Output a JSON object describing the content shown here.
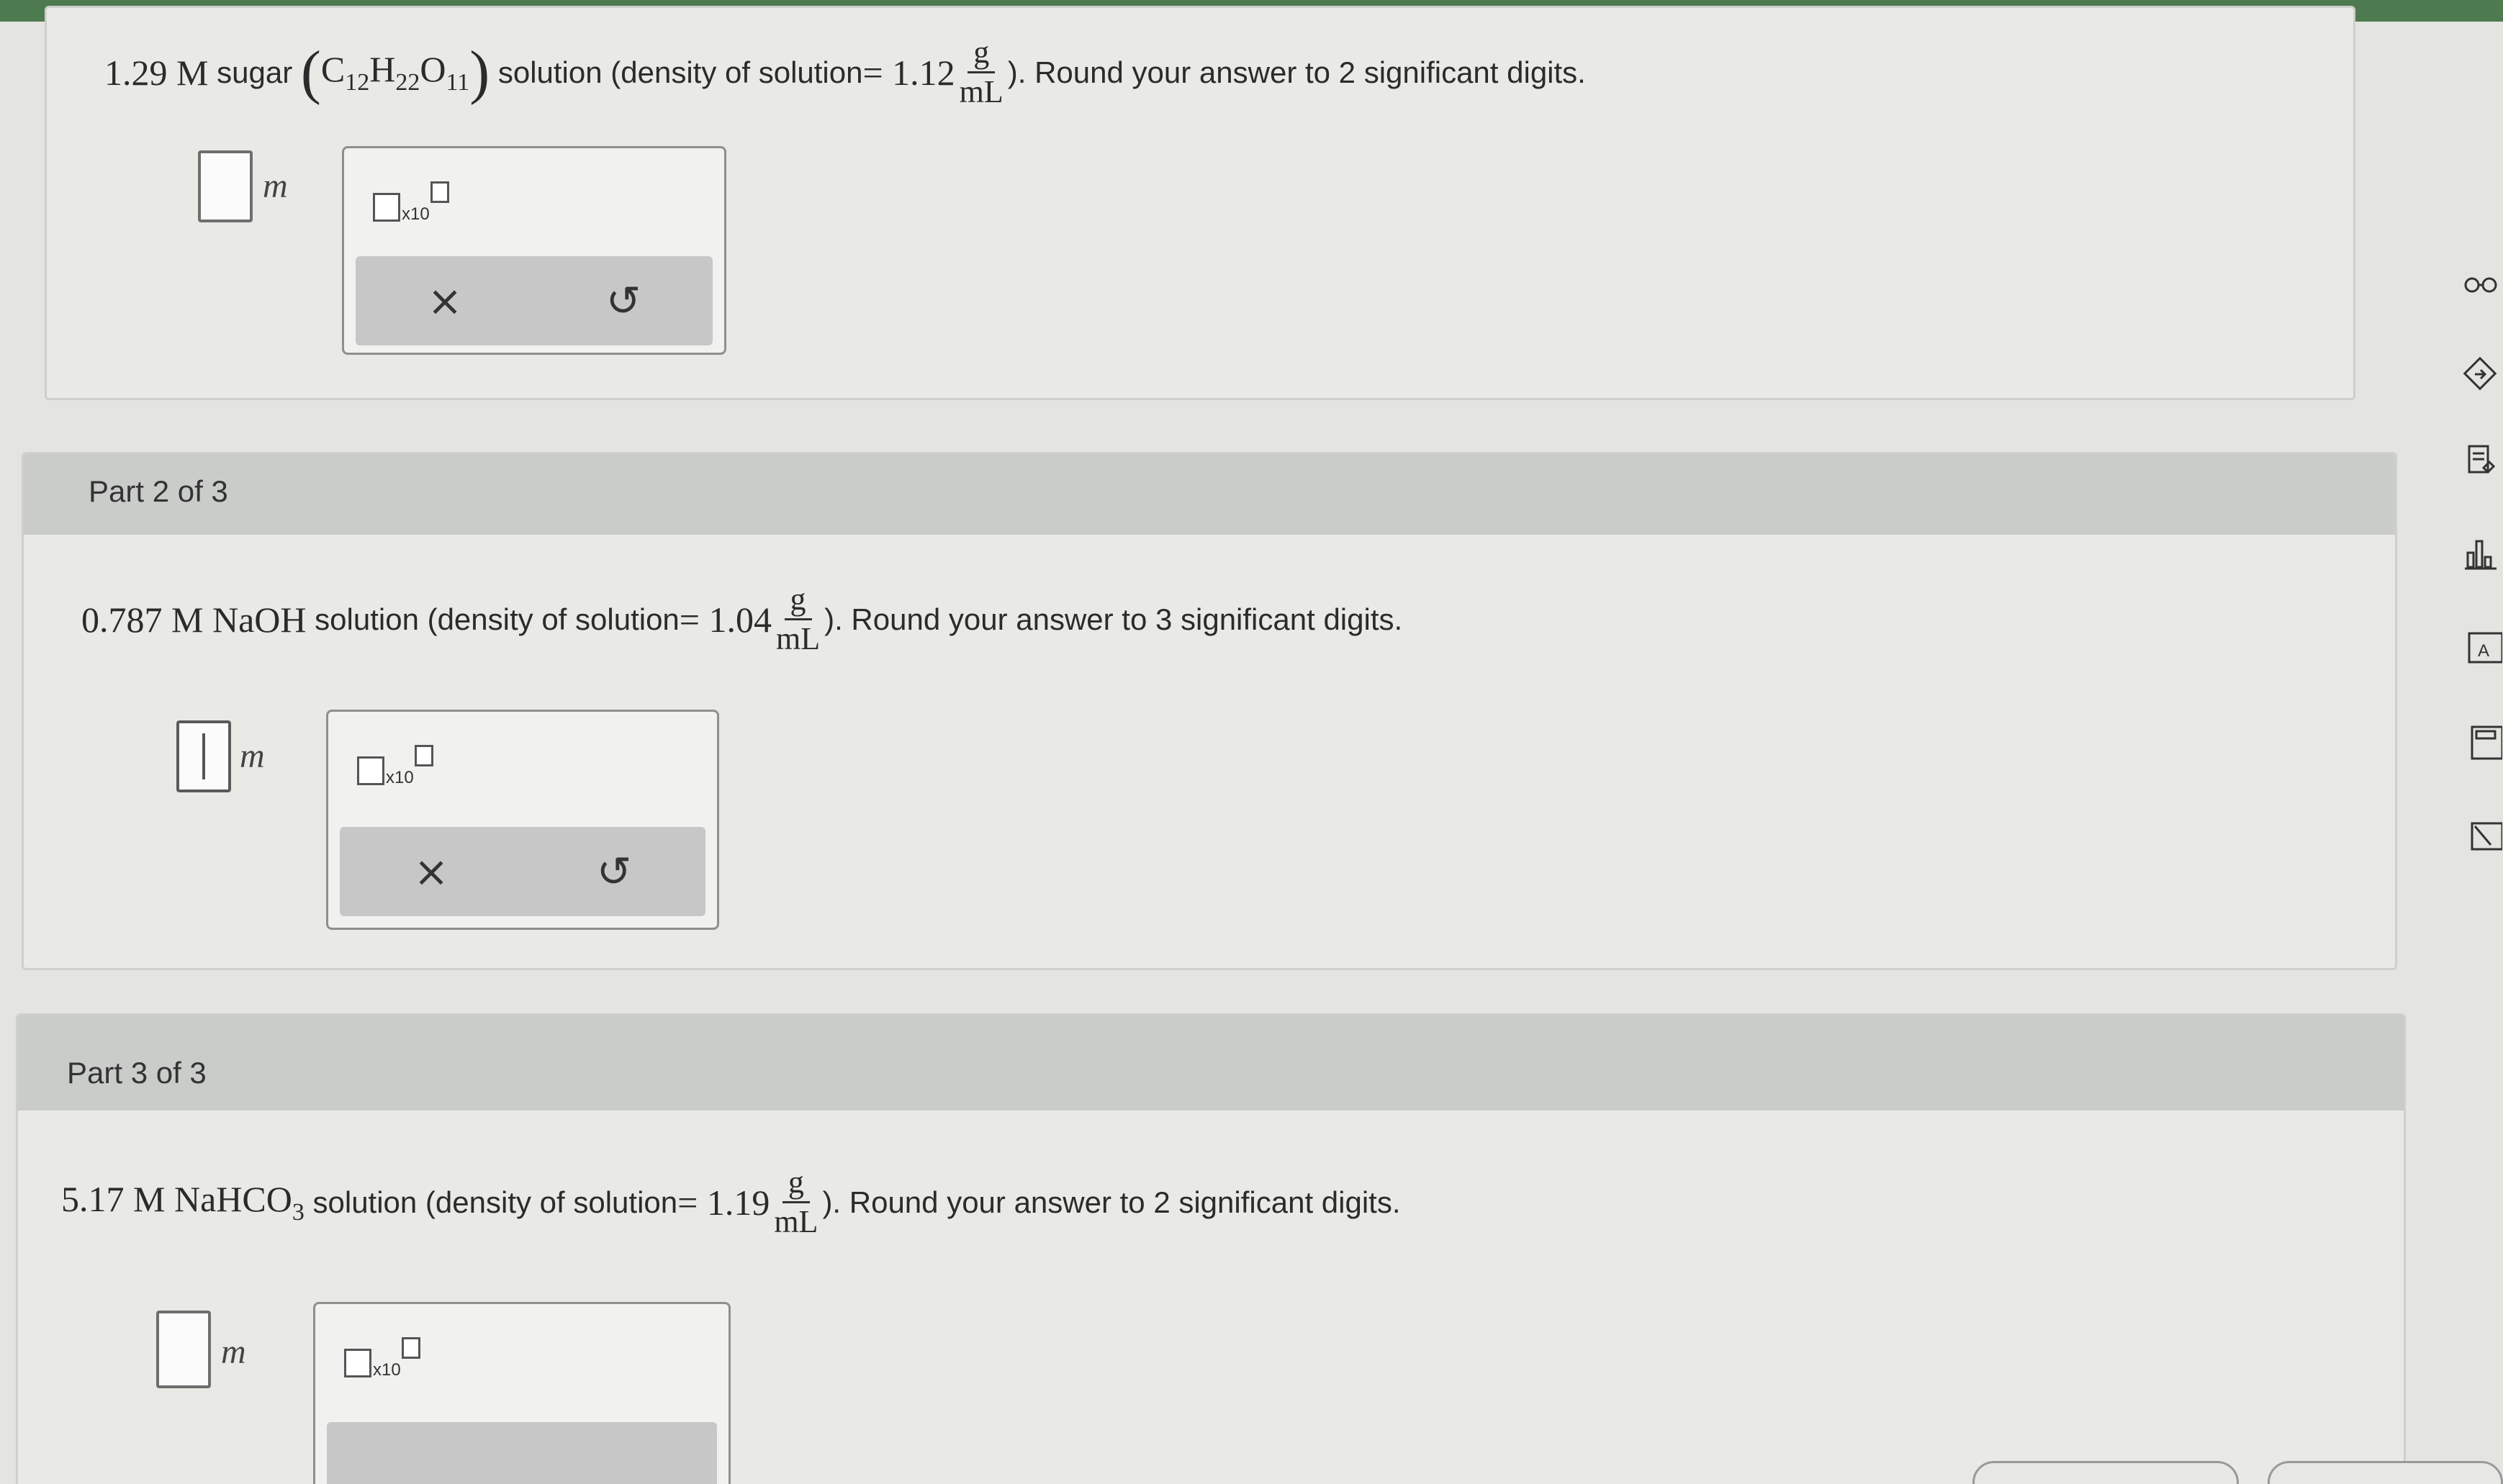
{
  "part1": {
    "prefix_molarity": "1.29 M",
    "prefix_text": "sugar",
    "formula": {
      "C": "C",
      "c_sub": "12",
      "H": "H",
      "h_sub": "22",
      "O": "O",
      "o_sub": "11"
    },
    "mid_text": "solution (density of solution",
    "eq": "= 1.12",
    "frac_num": "g",
    "frac_den": "mL",
    "suffix": "). Round your answer to 2 significant digits.",
    "unit": "m",
    "sci_x10": "x10",
    "clear_symbol": "×",
    "undo_symbol": "↺"
  },
  "part2": {
    "header": "Part 2 of 3",
    "prefix": "0.787 M NaOH",
    "mid_text": "solution (density of solution",
    "eq": "= 1.04",
    "frac_num": "g",
    "frac_den": "mL",
    "suffix": "). Round your answer to 3 significant digits.",
    "unit": "m",
    "sci_x10": "x10",
    "clear_symbol": "×",
    "undo_symbol": "↺"
  },
  "part3": {
    "header": "Part 3 of 3",
    "prefix": "5.17 M NaHCO",
    "prefix_sub": "3",
    "mid_text": "solution (density of solution",
    "eq": "= 1.19",
    "frac_num": "g",
    "frac_den": "mL",
    "suffix": "). Round your answer to 2 significant digits.",
    "unit": "m",
    "sci_x10": "x10"
  },
  "sidebar_icons": [
    "glasses-icon",
    "gradebook-icon",
    "clipboard-icon",
    "bar-chart-icon",
    "periodic-table-icon",
    "calculator-icon",
    "edit-icon"
  ],
  "colors": {
    "topbar": "#4e7a4f",
    "card_header": "#c9ccc9",
    "background": "#e4e4e1"
  }
}
